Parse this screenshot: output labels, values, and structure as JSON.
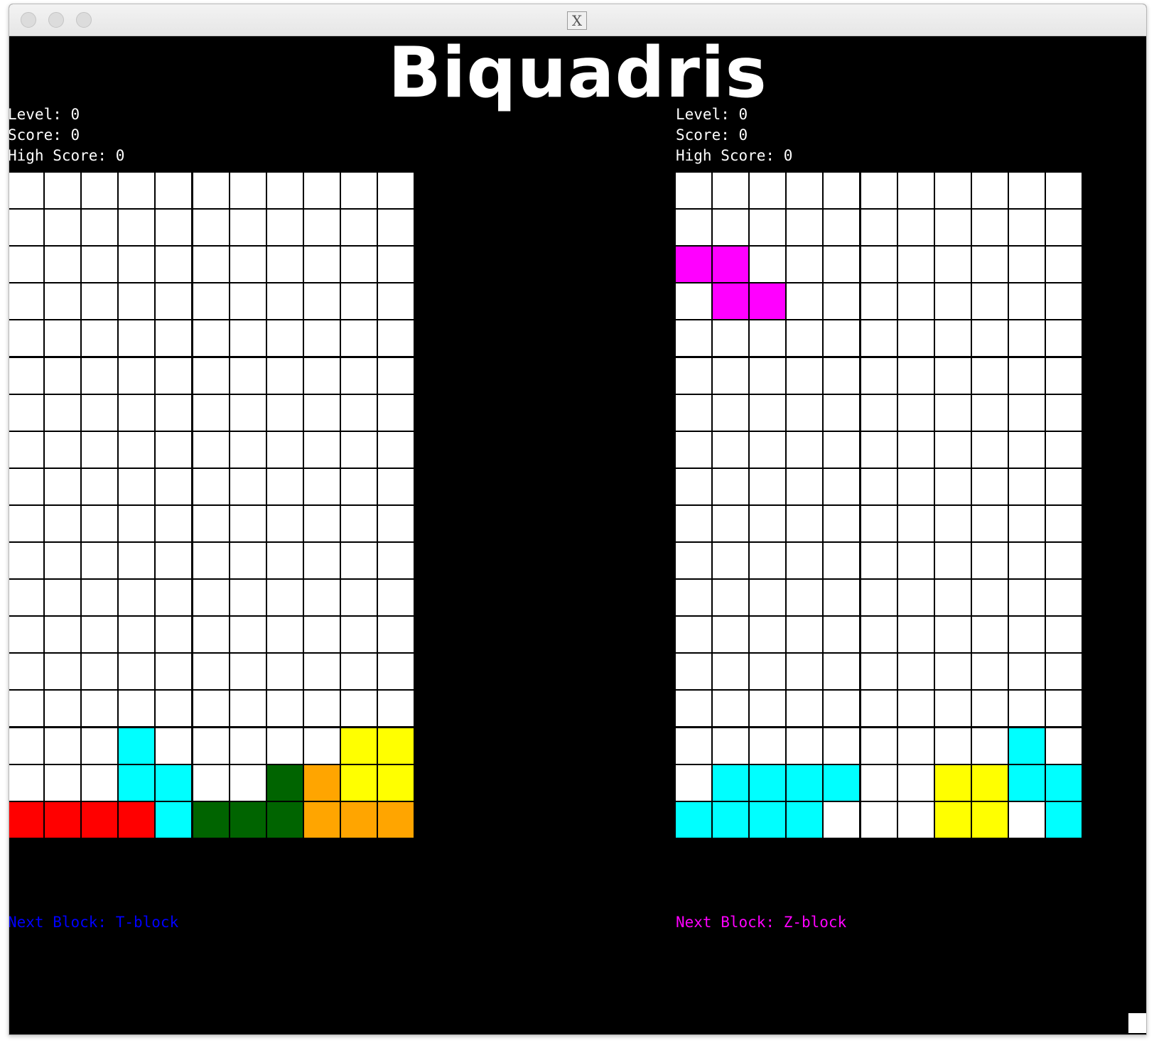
{
  "window": {
    "icon_glyph": "X",
    "icon_name": "x11-app-icon"
  },
  "title": "Biquadris",
  "colors": {
    "background": "#000000",
    "empty": "#ffffff",
    "I": "#00ffff",
    "L": "#ff0000",
    "S": "#006400",
    "T": "#ffa500",
    "O": "#ffff00",
    "Z": "#ff00ff",
    "next_block_p1": "#0000ff",
    "next_block_p2": "#ff00ff"
  },
  "players": [
    {
      "level_text": "Level: 0",
      "score_text": "Score: 0",
      "high_score_text": "High Score: 0",
      "next_block_text": "Next Block: T-block",
      "grid": [
        "...........",
        "...........",
        "...........",
        "...........",
        "...........",
        "...........",
        "...........",
        "...........",
        "...........",
        "...........",
        "...........",
        "...........",
        "...........",
        "...........",
        "...........",
        "...I.....OO",
        "...II..STOO",
        "LLLLISSSTTT"
      ]
    },
    {
      "level_text": "Level: 0",
      "score_text": "Score: 0",
      "high_score_text": "High Score: 0",
      "next_block_text": "Next Block: Z-block",
      "grid": [
        "...........",
        "...........",
        "ZZ.........",
        ".ZZ........",
        "...........",
        "...........",
        "...........",
        "...........",
        "...........",
        "...........",
        "...........",
        "...........",
        "...........",
        "...........",
        "...........",
        ".........I.",
        ".IIII..OOII",
        "IIII...OO.I"
      ]
    }
  ]
}
